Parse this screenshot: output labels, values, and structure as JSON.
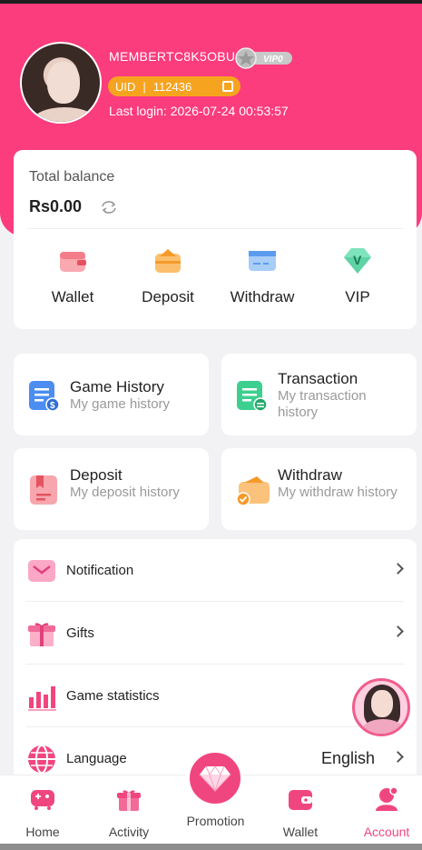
{
  "profile": {
    "username": "MEMBERTC8K5OBU",
    "vip_badge": "VIP0",
    "uid_label": "UID",
    "uid_value": "112436",
    "last_login": "Last login: 2026-07-24 00:53:57"
  },
  "balance": {
    "label": "Total balance",
    "value": "Rs0.00"
  },
  "quick_actions": [
    {
      "label": "Wallet",
      "icon": "wallet-icon"
    },
    {
      "label": "Deposit",
      "icon": "deposit-icon"
    },
    {
      "label": "Withdraw",
      "icon": "withdraw-icon"
    },
    {
      "label": "VIP",
      "icon": "vip-icon"
    }
  ],
  "history_cards": [
    {
      "title": "Game History",
      "subtitle": "My game history",
      "icon": "game-history-icon"
    },
    {
      "title": "Transaction",
      "subtitle": "My transaction history",
      "icon": "transaction-icon"
    },
    {
      "title": "Deposit",
      "subtitle": "My deposit history",
      "icon": "deposit-history-icon"
    },
    {
      "title": "Withdraw",
      "subtitle": "My withdraw history",
      "icon": "withdraw-history-icon"
    }
  ],
  "menu": [
    {
      "label": "Notification",
      "icon": "notification-icon"
    },
    {
      "label": "Gifts",
      "icon": "gift-icon"
    },
    {
      "label": "Game statistics",
      "icon": "statistics-icon"
    },
    {
      "label": "Language",
      "icon": "language-icon",
      "value": "English"
    }
  ],
  "tabbar": [
    {
      "label": "Home",
      "icon": "home-icon"
    },
    {
      "label": "Activity",
      "icon": "activity-icon"
    },
    {
      "label": "Promotion",
      "icon": "diamond-icon"
    },
    {
      "label": "Wallet",
      "icon": "wallet-tab-icon"
    },
    {
      "label": "Account",
      "icon": "account-icon",
      "active": true
    }
  ],
  "colors": {
    "brand_pink": "#fb3c7d",
    "accent_orange": "#f6a41f",
    "active_tab": "#f0467f"
  }
}
